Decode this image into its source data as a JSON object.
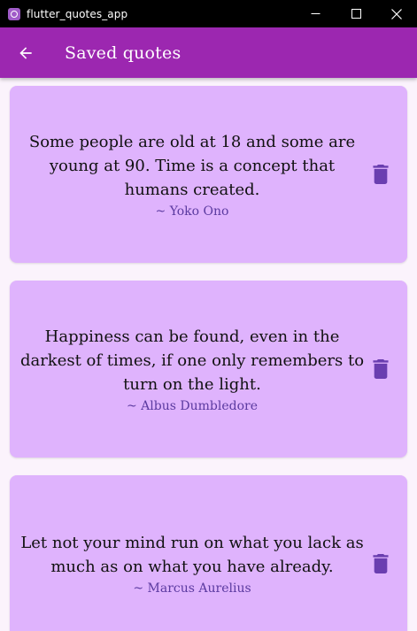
{
  "window": {
    "title": "flutter_quotes_app"
  },
  "appbar": {
    "title": "Saved quotes",
    "back_icon": "arrow-back-icon"
  },
  "colors": {
    "appbar": "#9c27b0",
    "card": "#dfb3fd",
    "author": "#5b3aa0",
    "delete_icon": "#6a3eb0"
  },
  "quotes": [
    {
      "text": "Some people are old at 18 and some are young at 90. Time is a concept that humans created.",
      "author": "~ Yoko Ono",
      "icon": "delete-icon"
    },
    {
      "text": "Happiness can be found, even in the darkest of times, if one only remembers to turn on the light.",
      "author": "~ Albus Dumbledore",
      "icon": "delete-icon"
    },
    {
      "text": "Let not your mind run on what you lack as much as on what you have already.",
      "author": "~ Marcus Aurelius",
      "icon": "delete-icon"
    }
  ]
}
